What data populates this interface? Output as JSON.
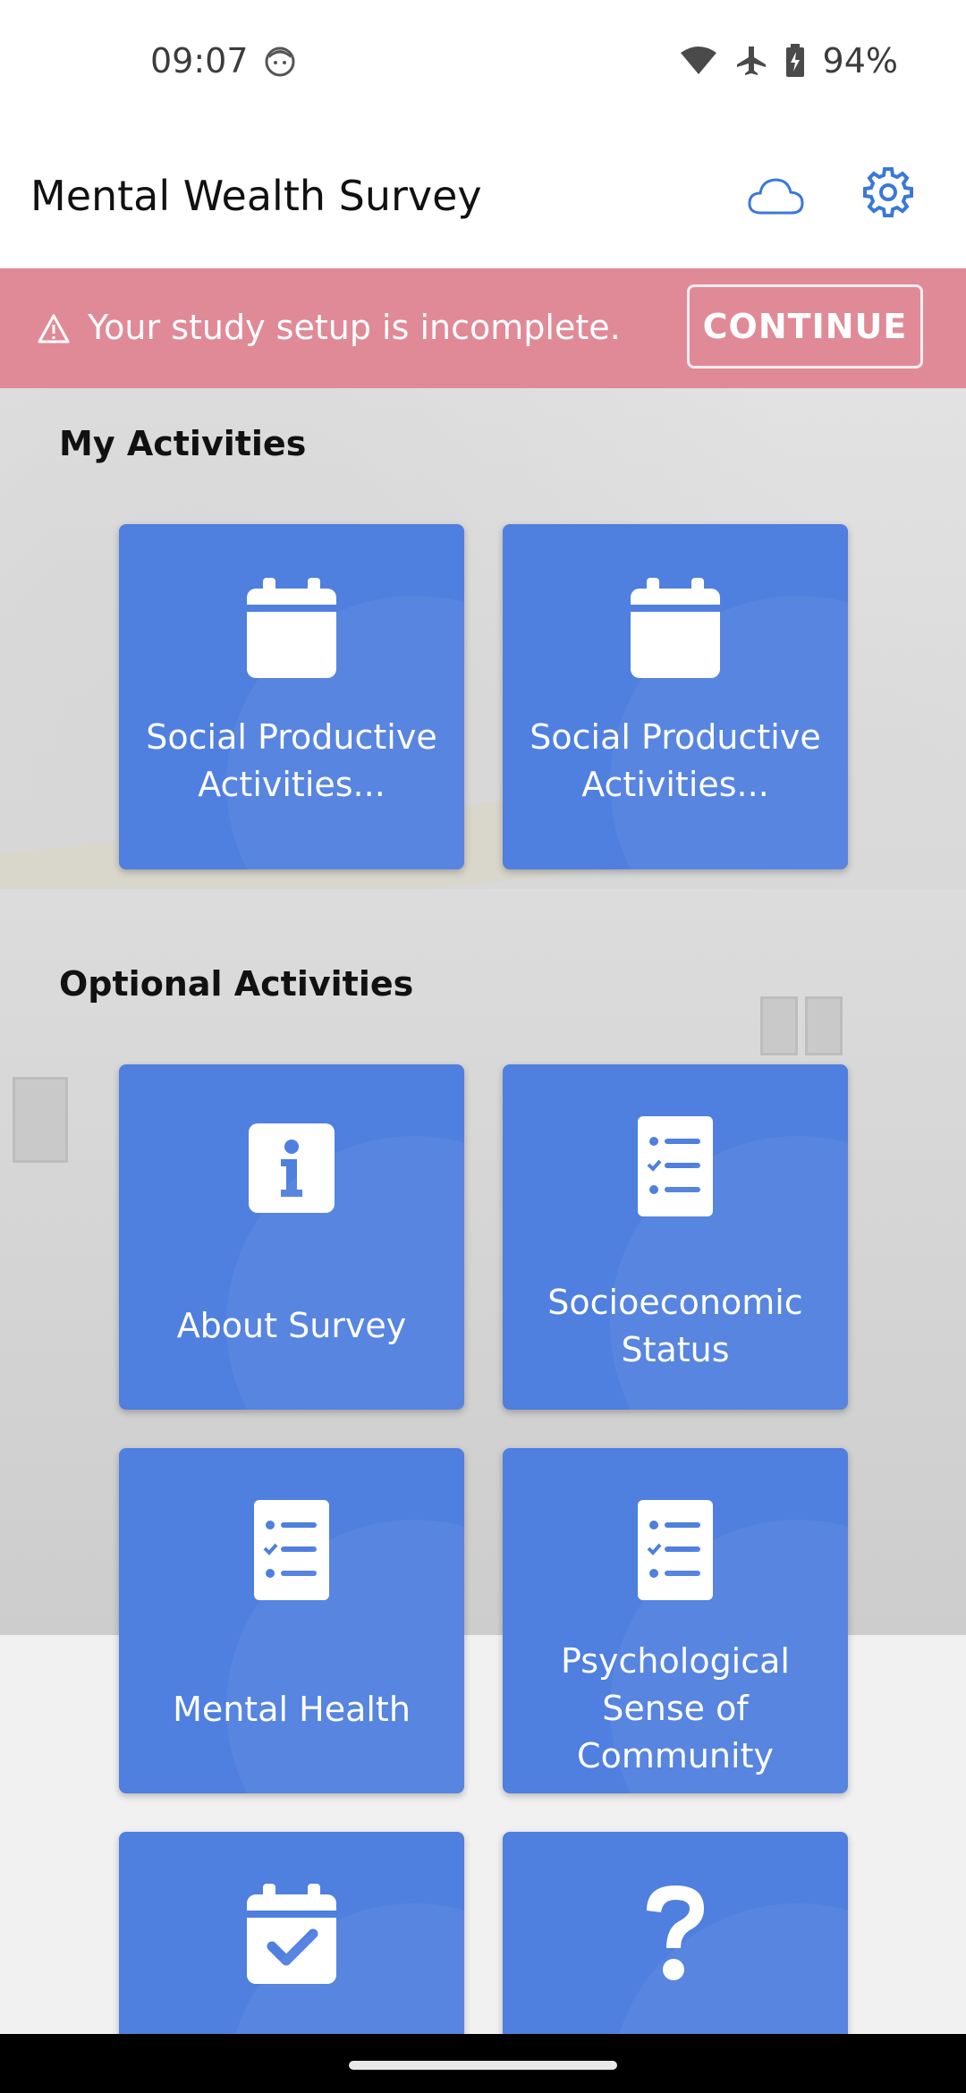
{
  "status": {
    "time": "09:07",
    "battery": "94%"
  },
  "app_bar": {
    "title": "Mental Wealth Survey"
  },
  "banner": {
    "text": "Your study setup is incomplete.",
    "button": "CONTINUE"
  },
  "sections": {
    "my_activities": "My Activities",
    "optional_activities": "Optional Activities"
  },
  "tiles": {
    "social_1": {
      "label": "Social Productive Activities...",
      "icon": "calendar-icon"
    },
    "social_2": {
      "label": "Social Productive Activities...",
      "icon": "calendar-icon"
    },
    "about": {
      "label": "About Survey",
      "icon": "info-icon"
    },
    "socioeconomic": {
      "label": "Socioeconomic Status",
      "icon": "checklist-icon"
    },
    "mental_health": {
      "label": "Mental Health",
      "icon": "checklist-icon"
    },
    "psych": {
      "label": "Psychological Sense of Community",
      "icon": "checklist-icon"
    },
    "calendar_check": {
      "icon": "calendar-check-icon"
    },
    "help": {
      "icon": "question-icon"
    }
  },
  "colors": {
    "tile_blue": "#4f7fdf",
    "banner": "#e08a97",
    "accent": "#3a78d8"
  }
}
